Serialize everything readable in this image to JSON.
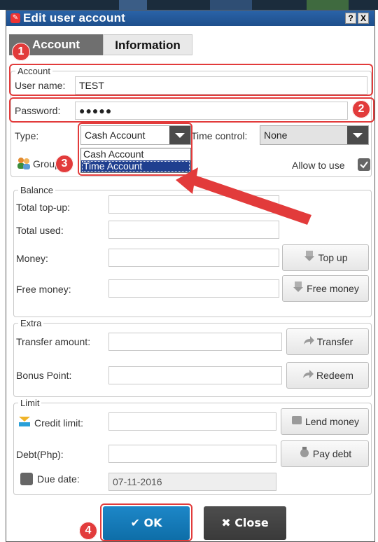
{
  "window": {
    "title": "Edit user account",
    "help_label": "?",
    "close_label": "X"
  },
  "tabs": [
    {
      "label": "Account",
      "active": true
    },
    {
      "label": "Information",
      "active": false
    }
  ],
  "account": {
    "legend": "Account",
    "username_label": "User name:",
    "username_value": "TEST",
    "password_label": "Password:",
    "password_value": "●●●●●",
    "type_label": "Type:",
    "type_value": "Cash Account",
    "type_options": [
      "Cash Account",
      "Time Account"
    ],
    "time_control_label": "Time control:",
    "time_control_value": "None",
    "group_label": "Group:",
    "allow_label": "Allow to use",
    "allow_checked": true
  },
  "balance": {
    "legend": "Balance",
    "topup_label": "Total top-up:",
    "used_label": "Total used:",
    "money_label": "Money:",
    "free_money_label": "Free money:",
    "topup_button": "Top up",
    "free_money_button": "Free money"
  },
  "extra": {
    "legend": "Extra",
    "transfer_label": "Transfer amount:",
    "bonus_label": "Bonus Point:",
    "transfer_button": "Transfer",
    "redeem_button": "Redeem"
  },
  "limit": {
    "legend": "Limit",
    "credit_label": "Credit limit:",
    "debt_label": "Debt(Php):",
    "due_label": "Due date:",
    "due_value": "07-11-2016",
    "lend_button": "Lend money",
    "pay_debt_button": "Pay debt"
  },
  "footer": {
    "ok_label": "OK",
    "close_label": "Close"
  },
  "annotations": {
    "badges": [
      "1",
      "2",
      "3",
      "4"
    ],
    "color": "#e23b3b"
  },
  "colors": {
    "titlebar": "#1e4f8c",
    "ok_button": "#0e6ea8",
    "close_button": "#3a3a3a",
    "selected_option": "#1f3f8f"
  }
}
